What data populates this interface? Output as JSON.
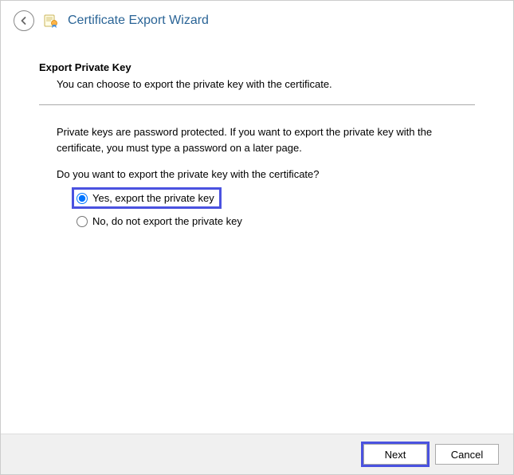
{
  "header": {
    "title": "Certificate Export Wizard"
  },
  "section": {
    "title": "Export Private Key",
    "description": "You can choose to export the private key with the certificate."
  },
  "body": {
    "info": "Private keys are password protected. If you want to export the private key with the certificate, you must type a password on a later page.",
    "question": "Do you want to export the private key with the certificate?"
  },
  "options": {
    "yes": "Yes, export the private key",
    "no": "No, do not export the private key",
    "selected": "yes"
  },
  "footer": {
    "next": "Next",
    "cancel": "Cancel"
  }
}
